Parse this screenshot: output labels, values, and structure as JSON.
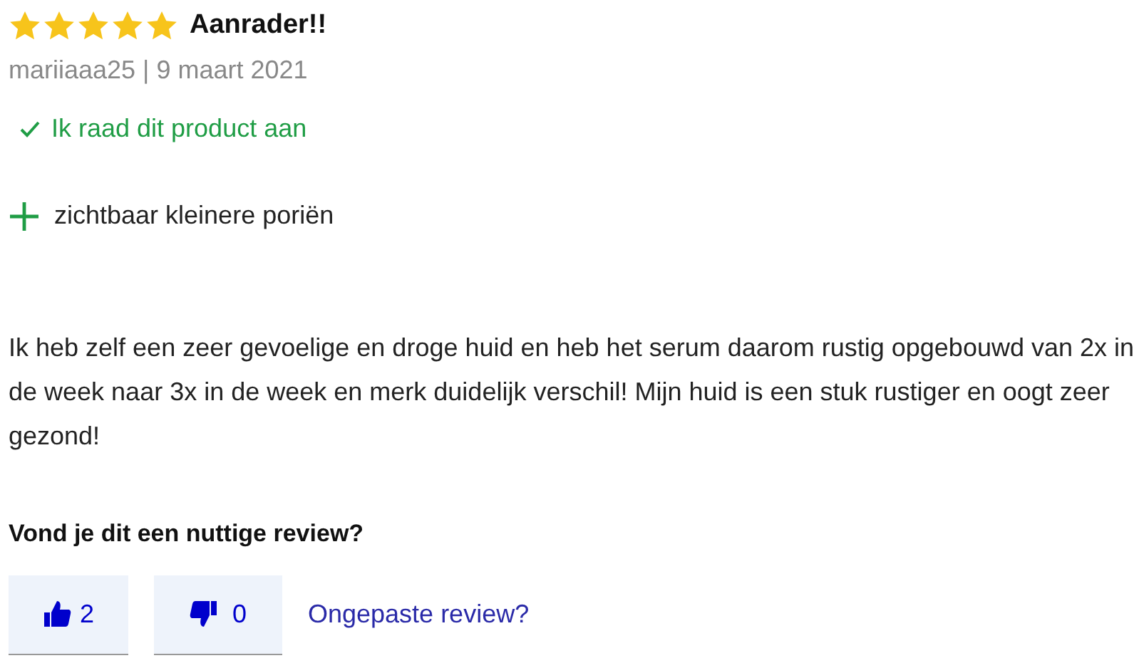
{
  "review": {
    "stars": 5,
    "title": "Aanrader!!",
    "meta": "mariiaaa25 | 9 maart 2021",
    "recommend": "Ik raad dit product aan",
    "pros": [
      "zichtbaar kleinere poriën"
    ],
    "body": "Ik heb zelf een zeer gevoelige en droge huid en heb het serum daarom rustig opgebouwd van 2x in de week naar 3x in de week en merk duidelijk verschil! Mijn huid is een stuk rustiger en oogt zeer gezond!"
  },
  "helpful": {
    "question": "Vond je dit een nuttige review?",
    "up_count": "2",
    "down_count": "0",
    "report_link": "Ongepaste review?"
  }
}
